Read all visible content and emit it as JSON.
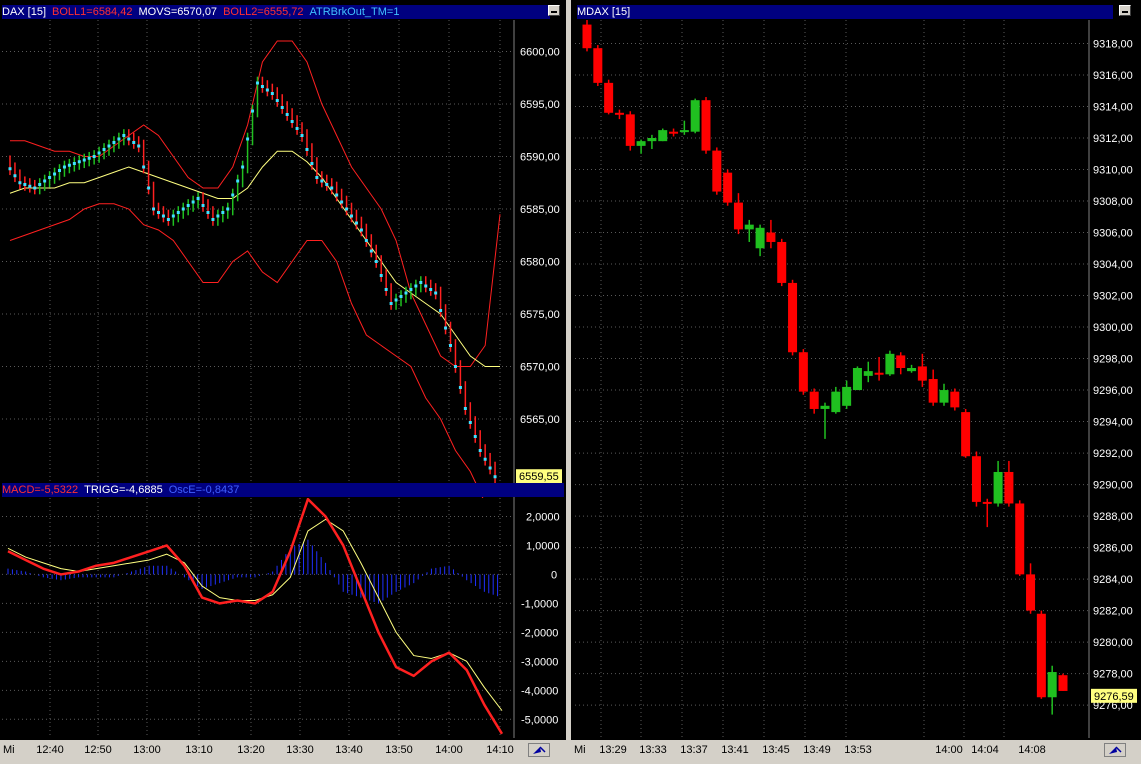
{
  "left_top": {
    "title_parts": [
      {
        "text": "DAX [15]",
        "color": "#ffffff"
      },
      {
        "text": "BOLL1=6584,42",
        "color": "#ff3030"
      },
      {
        "text": "MOVS=6570,07",
        "color": "#ffffff"
      },
      {
        "text": "BOLL2=6555,72",
        "color": "#ff3030"
      },
      {
        "text": "ATRBrkOut_TM=1",
        "color": "#40c0ff"
      }
    ],
    "y_ticks": [
      "6600,00",
      "6595,00",
      "6590,00",
      "6585,00",
      "6580,00",
      "6575,00",
      "6570,00",
      "6565,00"
    ],
    "last_price": "6559,55"
  },
  "left_bottom": {
    "title_parts": [
      {
        "text": "MACD=-5,5322",
        "color": "#ff3030"
      },
      {
        "text": "TRIGG=-4,6885",
        "color": "#ffffff"
      },
      {
        "text": "OscE=-0,8437",
        "color": "#4060ff"
      }
    ],
    "y_ticks": [
      "2,0000",
      "1,0000",
      "0",
      "-1,0000",
      "-2,0000",
      "-3,0000",
      "-4,0000",
      "-5,0000"
    ]
  },
  "left_time_axis": {
    "day_label": "Mi",
    "labels": [
      "12:40",
      "12:50",
      "13:00",
      "13:10",
      "13:20",
      "13:30",
      "13:40",
      "13:50",
      "14:00",
      "14:10"
    ]
  },
  "right": {
    "title_parts": [
      {
        "text": "MDAX [15]",
        "color": "#ffffff"
      }
    ],
    "y_ticks": [
      "9318,00",
      "9316,00",
      "9314,00",
      "9312,00",
      "9310,00",
      "9308,00",
      "9306,00",
      "9304,00",
      "9302,00",
      "9300,00",
      "9298,00",
      "9296,00",
      "9294,00",
      "9292,00",
      "9290,00",
      "9288,00",
      "9286,00",
      "9284,00",
      "9282,00",
      "9280,00",
      "9278,00",
      "9276,00"
    ],
    "last_price": "9276,59"
  },
  "right_time_axis": {
    "day_label": "Mi",
    "labels": [
      "13:29",
      "13:33",
      "13:37",
      "13:41",
      "13:45",
      "13:49",
      "13:53",
      "14:00",
      "14:04",
      "14:08"
    ]
  },
  "colors": {
    "up": "#20c020",
    "down": "#ff0000",
    "bollinger": "#ff2020",
    "moving_average": "#ffff80",
    "macd": "#ff2020",
    "trigger": "#ffff80",
    "oscillator": "#2030ff",
    "dax_bars": "#40e0ff",
    "grid": "#5a5a5a"
  },
  "chart_data": [
    {
      "type": "candlestick",
      "title": "DAX [15]",
      "ylim": [
        6559,
        6603
      ],
      "ticks": [
        "6600,00",
        "6595,00",
        "6590,00",
        "6585,00",
        "6580,00",
        "6575,00",
        "6570,00",
        "6565,00"
      ],
      "x": [
        "12:40",
        "12:50",
        "13:00",
        "13:10",
        "13:20",
        "13:30",
        "13:40",
        "13:50",
        "14:00",
        "14:10"
      ],
      "close_series": [
        6589.5,
        6587.5,
        6587,
        6588,
        6589,
        6589.5,
        6590,
        6591,
        6592,
        6591,
        6585,
        6584,
        6585,
        6586,
        6584,
        6585,
        6589,
        6597,
        6596,
        6594,
        6592,
        6588,
        6587,
        6585,
        6583,
        6580,
        6576,
        6577,
        6578,
        6577,
        6572,
        6566,
        6562,
        6559.5
      ],
      "bollinger_upper": [
        6591.5,
        6591.5,
        6591,
        6590.5,
        6590.5,
        6590,
        6590,
        6591,
        6592,
        6593,
        6592,
        6590,
        6588,
        6587,
        6587,
        6589,
        6593,
        6599,
        6601,
        6601,
        6599,
        6595,
        6592,
        6589,
        6587,
        6585,
        6582,
        6577,
        6574,
        6571,
        6570,
        6570,
        6572,
        6584.5
      ],
      "moving_average": [
        6586.5,
        6587,
        6587,
        6587,
        6587.5,
        6587.5,
        6588,
        6588.5,
        6589,
        6588.5,
        6588,
        6587.5,
        6587,
        6586.5,
        6586,
        6586,
        6587,
        6589,
        6590.5,
        6590.5,
        6589.5,
        6588,
        6586,
        6584,
        6582,
        6580,
        6578,
        6577,
        6576,
        6575,
        6573,
        6571,
        6570,
        6570
      ],
      "bollinger_lower": [
        6582,
        6582.5,
        6583,
        6583.5,
        6584,
        6585,
        6585.5,
        6585.5,
        6585,
        6583.5,
        6583,
        6582,
        6580,
        6578,
        6578,
        6580,
        6581,
        6579,
        6578,
        6580,
        6582,
        6582,
        6580,
        6576,
        6573,
        6572,
        6571,
        6570,
        6567,
        6565,
        6562,
        6560,
        6557,
        6555.7
      ]
    },
    {
      "type": "line",
      "title": "MACD",
      "ylim": [
        -5.3,
        2.5
      ],
      "series": [
        {
          "name": "MACD",
          "values": [
            0.8,
            0.5,
            0.2,
            0,
            0.1,
            0.3,
            0.4,
            0.6,
            0.8,
            1.0,
            0.3,
            -0.8,
            -1.0,
            -0.9,
            -1.0,
            -0.6,
            0.8,
            2.6,
            2.0,
            1.0,
            -0.5,
            -2.0,
            -3.2,
            -3.5,
            -3.0,
            -2.7,
            -3.3,
            -4.5,
            -5.5
          ]
        },
        {
          "name": "TRIGG",
          "values": [
            0.9,
            0.6,
            0.4,
            0.2,
            0.1,
            0.2,
            0.3,
            0.4,
            0.5,
            0.7,
            0.4,
            -0.4,
            -0.8,
            -0.9,
            -0.9,
            -0.7,
            -0.1,
            1.5,
            1.9,
            1.5,
            0.4,
            -0.8,
            -2.0,
            -2.8,
            -2.9,
            -2.7,
            -3.0,
            -3.9,
            -4.7
          ]
        },
        {
          "name": "OscE",
          "values": [
            0.2,
            0.1,
            -0.1,
            -0.2,
            -0.1,
            -0.1,
            -0.1,
            0.1,
            0.3,
            0.3,
            -0.1,
            -0.5,
            -0.3,
            -0.1,
            -0.1,
            0.1,
            0.9,
            1.2,
            0.4,
            -0.6,
            -0.8,
            -1.0,
            -0.6,
            -0.3,
            0.2,
            0.3,
            -0.2,
            -0.6,
            -0.8
          ]
        }
      ]
    },
    {
      "type": "candlestick",
      "title": "MDAX [15]",
      "ylim": [
        9275.5,
        9319.3
      ],
      "x": [
        "13:29",
        "13:33",
        "13:37",
        "13:41",
        "13:45",
        "13:49",
        "13:53",
        "14:00",
        "14:04",
        "14:08"
      ],
      "candles": [
        {
          "o": 9319.2,
          "h": 9319.5,
          "l": 9317.5,
          "c": 9317.7
        },
        {
          "o": 9317.7,
          "h": 9317.9,
          "l": 9315.3,
          "c": 9315.5
        },
        {
          "o": 9315.5,
          "h": 9315.7,
          "l": 9313.5,
          "c": 9313.6
        },
        {
          "o": 9313.6,
          "h": 9313.8,
          "l": 9313.2,
          "c": 9313.5
        },
        {
          "o": 9313.5,
          "h": 9313.7,
          "l": 9311.2,
          "c": 9311.5
        },
        {
          "o": 9311.5,
          "h": 9311.9,
          "l": 9311.0,
          "c": 9311.8
        },
        {
          "o": 9311.8,
          "h": 9312.2,
          "l": 9311.3,
          "c": 9312.0
        },
        {
          "o": 9311.8,
          "h": 9312.6,
          "l": 9311.8,
          "c": 9312.5
        },
        {
          "o": 9312.4,
          "h": 9312.6,
          "l": 9312.1,
          "c": 9312.3
        },
        {
          "o": 9312.4,
          "h": 9313.1,
          "l": 9312.2,
          "c": 9312.5
        },
        {
          "o": 9312.4,
          "h": 9314.5,
          "l": 9312.3,
          "c": 9314.4
        },
        {
          "o": 9314.4,
          "h": 9314.6,
          "l": 9311.0,
          "c": 9311.2
        },
        {
          "o": 9311.2,
          "h": 9311.4,
          "l": 9308.4,
          "c": 9308.6
        },
        {
          "o": 9309.8,
          "h": 9310.0,
          "l": 9307.7,
          "c": 9307.9
        },
        {
          "o": 9307.9,
          "h": 9308.5,
          "l": 9305.9,
          "c": 9306.2
        },
        {
          "o": 9306.2,
          "h": 9306.8,
          "l": 9305.4,
          "c": 9306.5
        },
        {
          "o": 9305.0,
          "h": 9306.5,
          "l": 9304.5,
          "c": 9306.3
        },
        {
          "o": 9306.0,
          "h": 9306.8,
          "l": 9305.0,
          "c": 9305.4
        },
        {
          "o": 9305.4,
          "h": 9305.6,
          "l": 9302.6,
          "c": 9302.8
        },
        {
          "o": 9302.8,
          "h": 9303.0,
          "l": 9298.2,
          "c": 9298.4
        },
        {
          "o": 9298.4,
          "h": 9298.6,
          "l": 9295.7,
          "c": 9295.9
        },
        {
          "o": 9295.9,
          "h": 9296.1,
          "l": 9294.5,
          "c": 9294.8
        },
        {
          "o": 9294.8,
          "h": 9295.2,
          "l": 9292.9,
          "c": 9295.0
        },
        {
          "o": 9294.6,
          "h": 9296.2,
          "l": 9294.5,
          "c": 9295.9
        },
        {
          "o": 9295.0,
          "h": 9296.6,
          "l": 9294.8,
          "c": 9296.2
        },
        {
          "o": 9296.0,
          "h": 9297.5,
          "l": 9296.0,
          "c": 9297.4
        },
        {
          "o": 9296.9,
          "h": 9297.8,
          "l": 9296.5,
          "c": 9297.2
        },
        {
          "o": 9297.1,
          "h": 9298.1,
          "l": 9296.6,
          "c": 9297.0
        },
        {
          "o": 9297.0,
          "h": 9298.5,
          "l": 9296.9,
          "c": 9298.3
        },
        {
          "o": 9298.2,
          "h": 9298.4,
          "l": 9297.0,
          "c": 9297.4
        },
        {
          "o": 9297.2,
          "h": 9297.6,
          "l": 9297.1,
          "c": 9297.4
        },
        {
          "o": 9297.5,
          "h": 9298.3,
          "l": 9296.2,
          "c": 9296.6
        },
        {
          "o": 9296.7,
          "h": 9297.3,
          "l": 9295.0,
          "c": 9295.2
        },
        {
          "o": 9295.2,
          "h": 9296.4,
          "l": 9295.0,
          "c": 9296.0
        },
        {
          "o": 9295.9,
          "h": 9296.1,
          "l": 9294.7,
          "c": 9294.9
        },
        {
          "o": 9294.6,
          "h": 9294.8,
          "l": 9291.7,
          "c": 9291.8
        },
        {
          "o": 9291.8,
          "h": 9292.1,
          "l": 9288.6,
          "c": 9288.9
        },
        {
          "o": 9288.9,
          "h": 9289.1,
          "l": 9287.3,
          "c": 9288.8
        },
        {
          "o": 9288.8,
          "h": 9291.5,
          "l": 9288.6,
          "c": 9290.8
        },
        {
          "o": 9290.8,
          "h": 9291.5,
          "l": 9288.6,
          "c": 9288.8
        },
        {
          "o": 9288.8,
          "h": 9289.0,
          "l": 9284.2,
          "c": 9284.3
        },
        {
          "o": 9284.3,
          "h": 9285.0,
          "l": 9281.8,
          "c": 9282.0
        },
        {
          "o": 9281.8,
          "h": 9282.0,
          "l": 9276.4,
          "c": 9276.5
        },
        {
          "o": 9276.5,
          "h": 9278.5,
          "l": 9275.4,
          "c": 9278.1
        },
        {
          "o": 9277.9,
          "h": 9278.0,
          "l": 9276.9,
          "c": 9276.9
        }
      ]
    }
  ]
}
